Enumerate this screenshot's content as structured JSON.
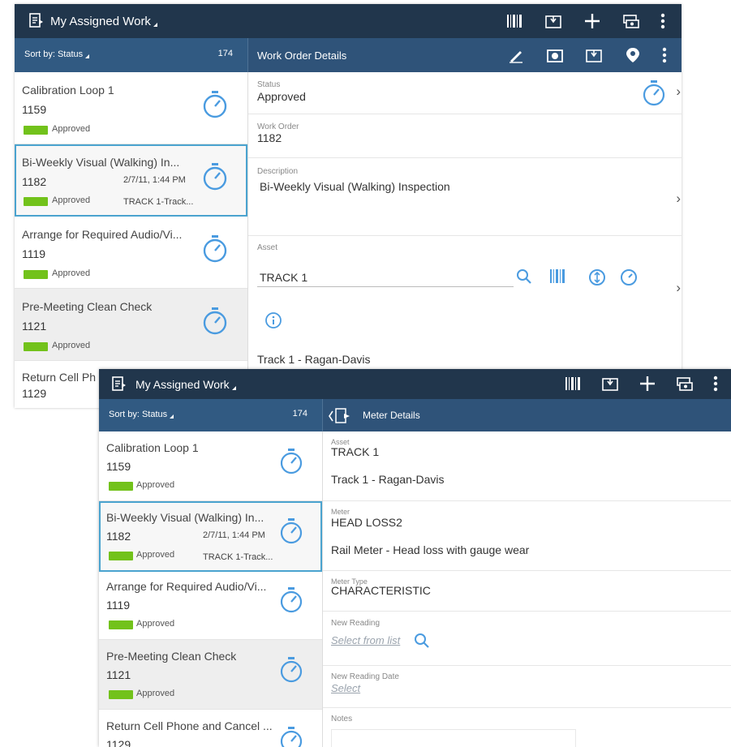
{
  "screen1": {
    "app_title": "My Assigned Work",
    "sort_label": "Sort by: Status",
    "count": "174",
    "detail_title": "Work Order Details",
    "list": [
      {
        "name": "Calibration Loop 1",
        "num": "1159",
        "status": "Approved"
      },
      {
        "name": "Bi-Weekly Visual (Walking) In...",
        "num": "1182",
        "status": "Approved",
        "date": "2/7/11, 1:44 PM",
        "location": "TRACK 1-Track..."
      },
      {
        "name": "Arrange for Required Audio/Vi...",
        "num": "1119",
        "status": "Approved"
      },
      {
        "name": "Pre-Meeting Clean Check",
        "num": "1121",
        "status": "Approved"
      },
      {
        "name": "Return Cell Ph",
        "num": "1129"
      }
    ],
    "details": {
      "status_label": "Status",
      "status_value": "Approved",
      "wo_label": "Work Order",
      "wo_value": "1182",
      "desc_label": "Description",
      "desc_value": "Bi-Weekly Visual (Walking) Inspection",
      "asset_label": "Asset",
      "asset_value": "TRACK 1",
      "asset_desc": "Track 1 - Ragan-Davis"
    }
  },
  "screen2": {
    "app_title": "My Assigned Work",
    "sort_label": "Sort by: Status",
    "count": "174",
    "detail_title": "Meter Details",
    "list": [
      {
        "name": "Calibration Loop 1",
        "num": "1159",
        "status": "Approved"
      },
      {
        "name": "Bi-Weekly Visual (Walking) In...",
        "num": "1182",
        "status": "Approved",
        "date": "2/7/11, 1:44 PM",
        "location": "TRACK 1-Track..."
      },
      {
        "name": "Arrange for Required Audio/Vi...",
        "num": "1119",
        "status": "Approved"
      },
      {
        "name": "Pre-Meeting Clean Check",
        "num": "1121",
        "status": "Approved"
      },
      {
        "name": "Return Cell Phone and Cancel ...",
        "num": "1129"
      }
    ],
    "meter": {
      "asset_label": "Asset",
      "asset_value": "TRACK 1",
      "asset_desc": "Track 1 - Ragan-Davis",
      "meter_label": "Meter",
      "meter_value": "HEAD LOSS2",
      "meter_desc": "Rail Meter - Head loss with gauge wear",
      "type_label": "Meter Type",
      "type_value": "CHARACTERISTIC",
      "reading_label": "New Reading",
      "reading_placeholder": "Select from list",
      "date_label": "New Reading Date",
      "date_placeholder": "Select",
      "notes_label": "Notes"
    }
  },
  "colors": {
    "topbar": "#21364c",
    "subbar": "#315a82",
    "approved": "#72c21b",
    "accent": "#4aa3cf"
  }
}
